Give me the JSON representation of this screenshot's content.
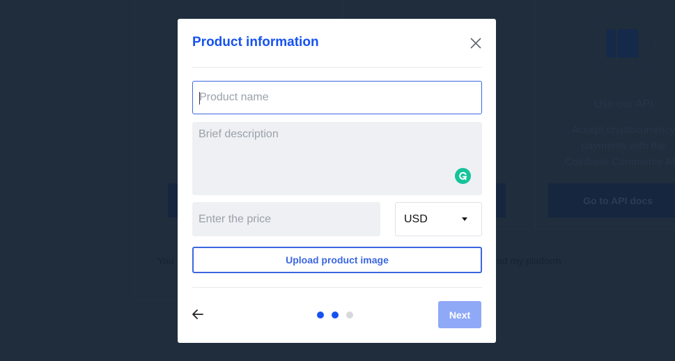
{
  "background": {
    "api_card": {
      "title": "Use our API",
      "description_lines": [
        "Accept cryptocurrency",
        "payments with the",
        "Coinbase Commerce API"
      ],
      "button_label": "Go to API docs"
    },
    "footer_left_fragment": "You",
    "footer_right_fragment": "nd my platform"
  },
  "modal": {
    "title": "Product information",
    "close_icon": "close-icon",
    "fields": {
      "name": {
        "value": "",
        "placeholder": "Product name"
      },
      "description": {
        "value": "",
        "placeholder": "Brief description"
      },
      "price": {
        "value": "",
        "placeholder": "Enter the price"
      },
      "currency": {
        "selected": "USD"
      }
    },
    "upload_label": "Upload product image",
    "footer": {
      "back_icon": "arrow-left-icon",
      "steps": {
        "total": 3,
        "completed": 2
      },
      "next_label": "Next",
      "next_enabled": false
    }
  },
  "colors": {
    "accent": "#1652f0",
    "overlay": "#1f2d3d",
    "input_bg": "#eef0f3",
    "next_disabled": "#8fa9f7",
    "grammarly": "#15c39a"
  }
}
